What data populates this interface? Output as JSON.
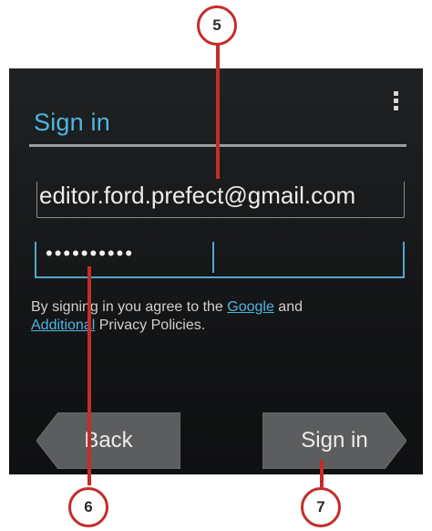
{
  "header": {
    "title": "Sign in",
    "menu_icon": "overflow-menu-icon"
  },
  "form": {
    "email_value": "editor.ford.prefect@gmail.com",
    "password_mask": "••••••••••"
  },
  "terms": {
    "prefix": "By signing in you agree to the ",
    "link_google": "Google",
    "middle": " and",
    "link_additional": "Additional",
    "suffix": " Privacy Policies."
  },
  "buttons": {
    "back_label": "Back",
    "sign_in_label": "Sign in"
  },
  "callouts": {
    "c5": "5",
    "c6": "6",
    "c7": "7"
  },
  "colors": {
    "accent": "#4fb6e0",
    "callout": "#c42c2a",
    "background": "#141516"
  }
}
